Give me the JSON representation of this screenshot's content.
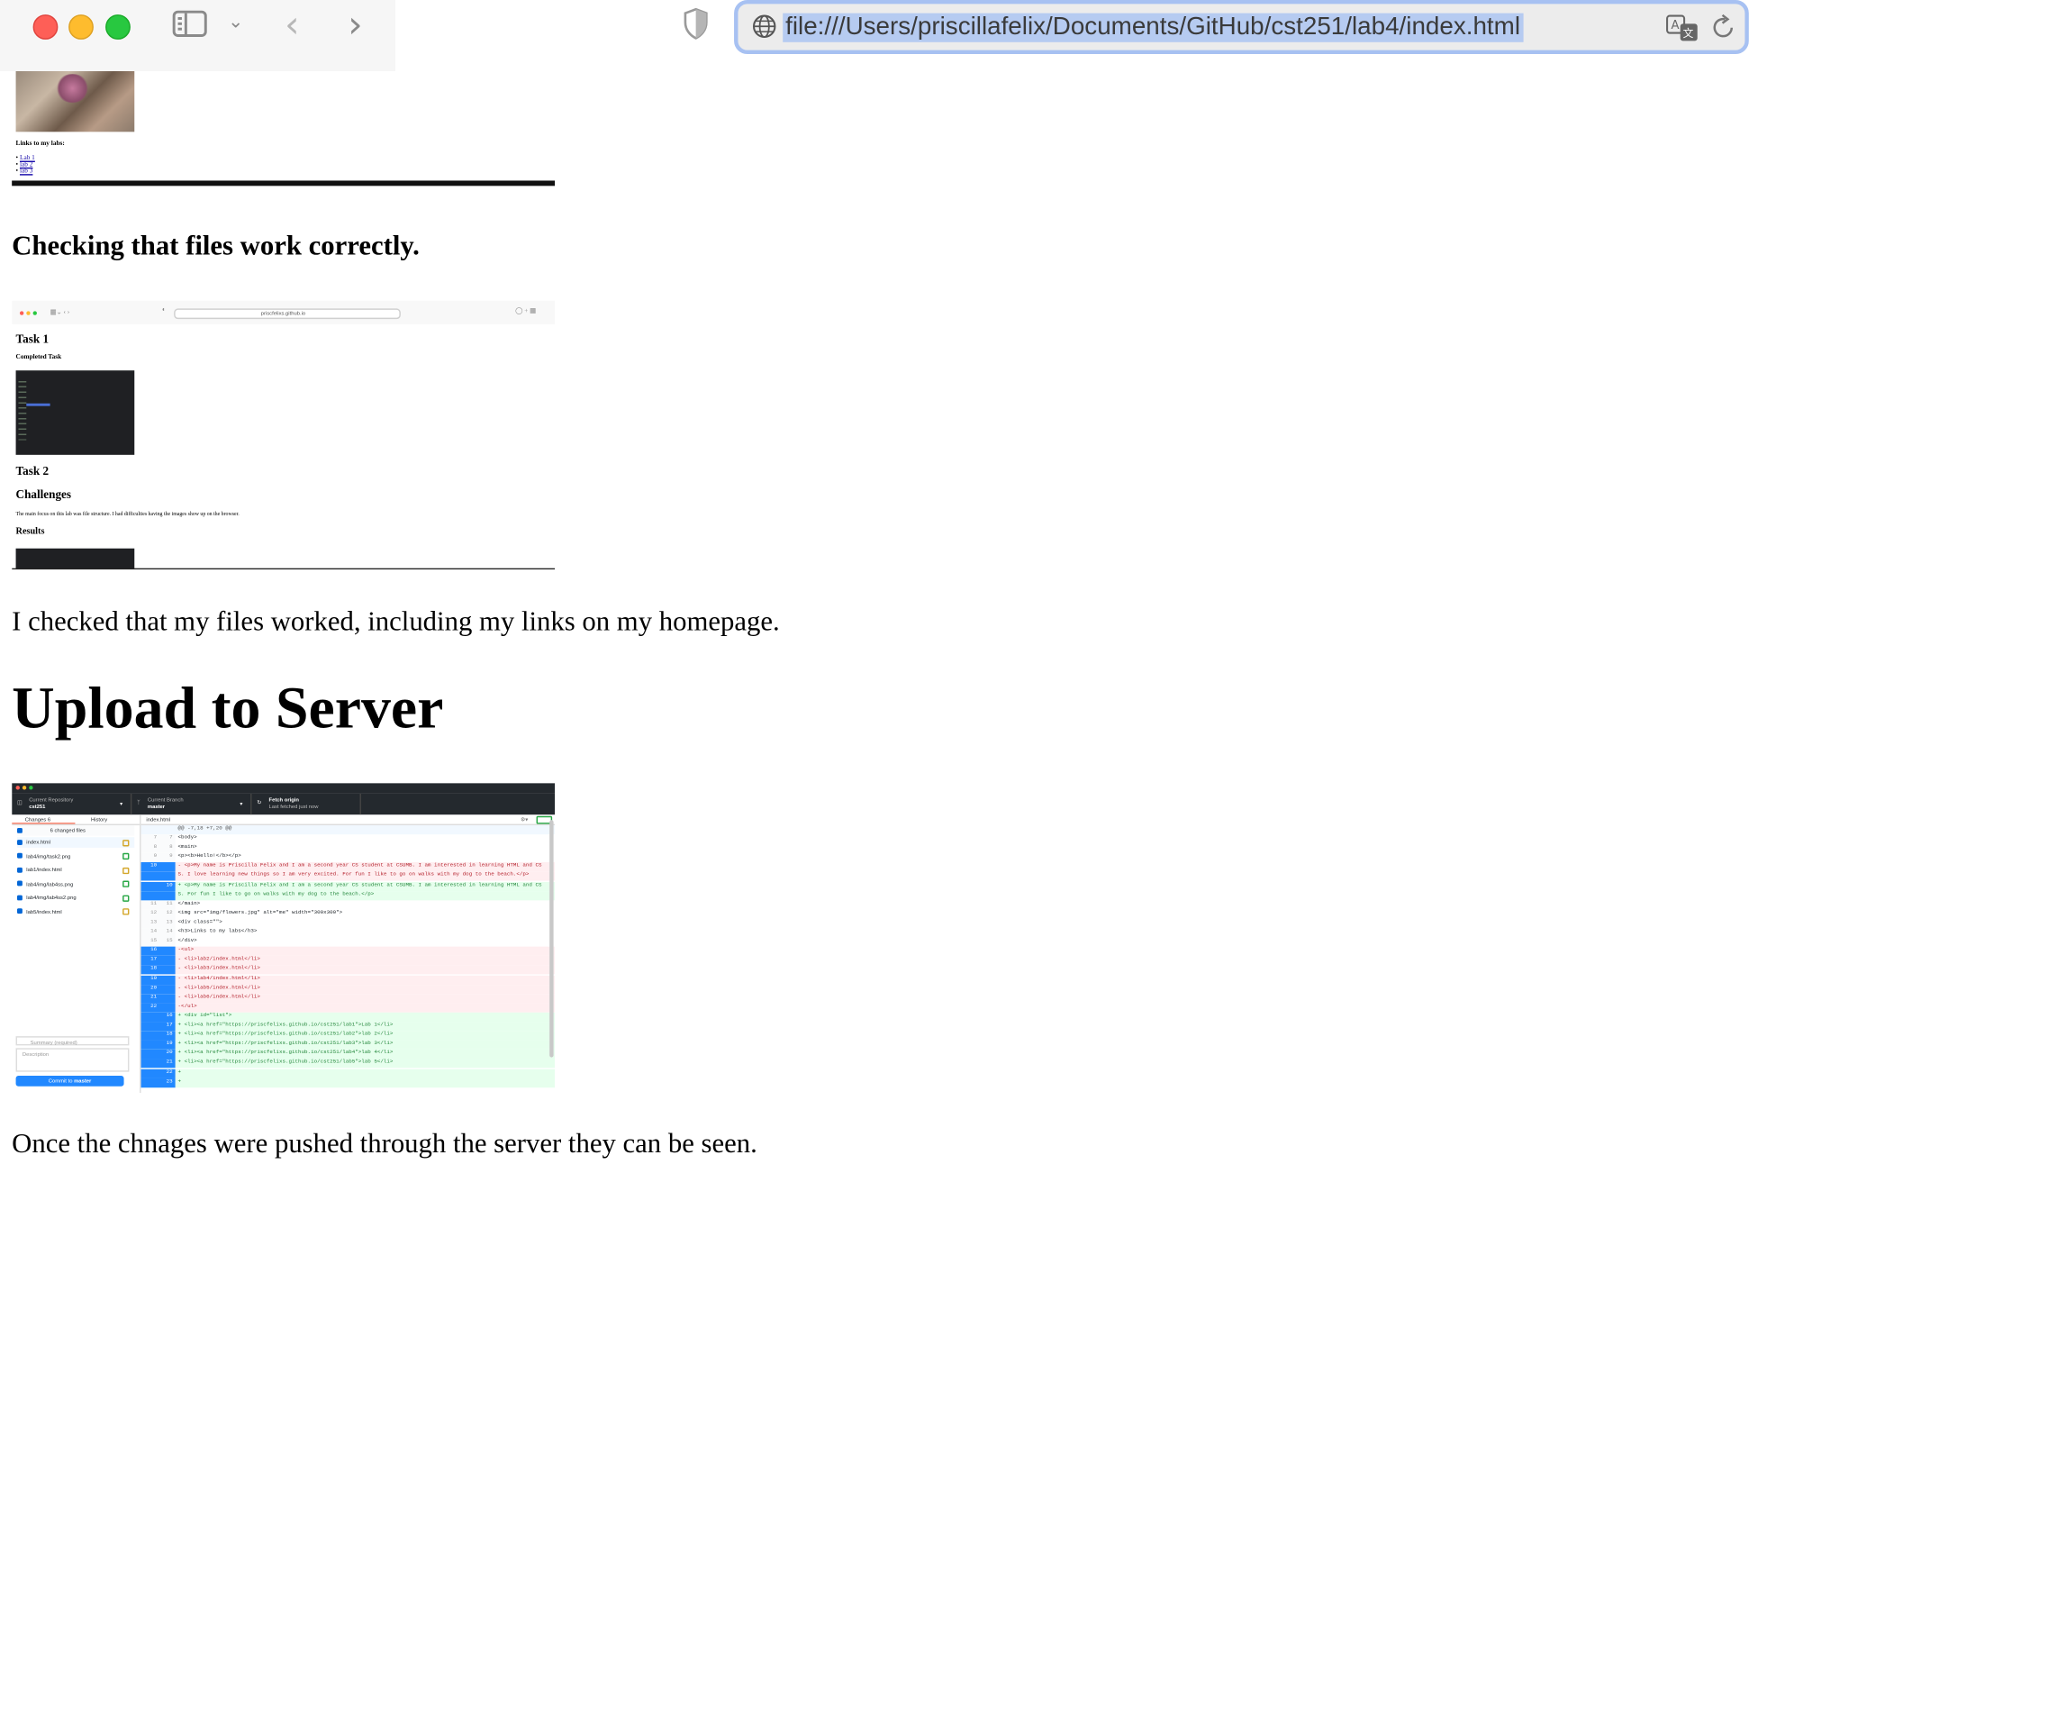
{
  "browser": {
    "url": "file:///Users/priscillafelix/Documents/GitHub/cst251/lab4/index.html",
    "icons": [
      "traffic-light-close",
      "traffic-light-minimize",
      "traffic-light-zoom",
      "sidebar-icon",
      "chevron-down-icon",
      "back-arrow-icon",
      "forward-arrow-icon",
      "shield-icon",
      "globe-icon",
      "translate-icon",
      "reload-icon"
    ]
  },
  "shot1": {
    "links_heading": "Links to my labs:",
    "links": [
      "Lab 1",
      "lab 2",
      "lab 3"
    ]
  },
  "section_check": {
    "heading": "Checking that files work correctly.",
    "caption": "I checked that my files worked, including my links on my homepage."
  },
  "shot2": {
    "url": "priscfelixs.github.io",
    "task1": "Task 1",
    "completed": "Completed Task",
    "task2": "Task 2",
    "challenges": "Challenges",
    "challenges_text": "The main focus on this lab was file structure. I had difficulties having the images show up on the browser.",
    "results": "Results"
  },
  "section_upload": {
    "heading": "Upload to Server",
    "caption": "Once the chnages were pushed through the server they can be seen."
  },
  "github_desktop": {
    "repo_label": "Current Repository",
    "repo": "cst251",
    "branch_label": "Current Branch",
    "branch": "master",
    "fetch_label": "Fetch origin",
    "fetch_sub": "Last fetched just now",
    "tab_changes": "Changes",
    "tab_changes_count": "6",
    "tab_history": "History",
    "changed_files": "6 changed files",
    "files": [
      "index.html",
      "lab4/img/task2.png",
      "lab1/index.html",
      "lab4/img/lab4ss.png",
      "lab4/img/lab4ss2.png",
      "lab5/index.html"
    ],
    "diff_file": "index.html",
    "hunk": "@@ -7,18 +7,20 @@",
    "summary_placeholder": "Summary (required)",
    "description_placeholder": "Description",
    "commit_prefix": "Commit to",
    "commit_branch": "master",
    "diff_lines": [
      {
        "o": "7",
        "n": "7",
        "t": "ctx",
        "s": "  <body>"
      },
      {
        "o": "8",
        "n": "8",
        "t": "ctx",
        "s": "    <main>"
      },
      {
        "o": "9",
        "n": "9",
        "t": "ctx",
        "s": "    <p><b>Hello!</b></p>"
      },
      {
        "o": "10",
        "n": "",
        "t": "del",
        "s": "-       <p>My name is Priscilla Felix and I am a second year CS student at CSUMB. I am interested in learning HTML and CS"
      },
      {
        "o": "",
        "n": "",
        "t": "del",
        "s": "S. I love learning new things so I am very excited. For fun I like to go on walks with my dog to the beach.</p>"
      },
      {
        "o": "",
        "n": "10",
        "t": "add",
        "s": "+       <p>My name is Priscilla Felix and I am a second year CS student at CSUMB. I am interested in learning HTML and CS"
      },
      {
        "o": "",
        "n": "",
        "t": "add",
        "s": "S. For fun I like to go on walks with my dog to the beach.</p>"
      },
      {
        "o": "11",
        "n": "11",
        "t": "ctx",
        "s": "    </main>"
      },
      {
        "o": "12",
        "n": "12",
        "t": "ctx",
        "s": "  <img src=\"img/flowers.jpg\" alt=\"me\" width=\"300x300\">"
      },
      {
        "o": "13",
        "n": "13",
        "t": "ctx",
        "s": "  <div class=\"\">"
      },
      {
        "o": "14",
        "n": "14",
        "t": "ctx",
        "s": "    <h3>Links to my labs</h3>"
      },
      {
        "o": "15",
        "n": "15",
        "t": "ctx",
        "s": "  </div>"
      },
      {
        "o": "16",
        "n": "",
        "t": "del",
        "s": "-<ul>"
      },
      {
        "o": "17",
        "n": "",
        "t": "del",
        "s": "-    <li>lab2/index.html</li>"
      },
      {
        "o": "18",
        "n": "",
        "t": "del",
        "s": "-    <li>lab3/index.html</li>"
      },
      {
        "o": "19",
        "n": "",
        "t": "del",
        "s": "-    <li>lab4/index.html</li>"
      },
      {
        "o": "20",
        "n": "",
        "t": "del",
        "s": "-    <li>lab5/index.html</li>"
      },
      {
        "o": "21",
        "n": "",
        "t": "del",
        "s": "-    <li>lab6/index.html</li>"
      },
      {
        "o": "22",
        "n": "",
        "t": "del",
        "s": "-</ul>"
      },
      {
        "o": "",
        "n": "16",
        "t": "add",
        "s": "+   <div id=\"list\">"
      },
      {
        "o": "",
        "n": "17",
        "t": "add",
        "s": "+   <li><a href=\"https://priscfelixs.github.io/cst251/lab1\">Lab 1</li>"
      },
      {
        "o": "",
        "n": "18",
        "t": "add",
        "s": "+   <li><a href=\"https://priscfelixs.github.io/cst251/lab2\">lab 2</li>"
      },
      {
        "o": "",
        "n": "19",
        "t": "add",
        "s": "+   <li><a href=\"https://priscfelixs.github.io/cst251/lab3\">lab 3</li>"
      },
      {
        "o": "",
        "n": "20",
        "t": "add",
        "s": "+   <li><a href=\"https://priscfelixs.github.io/cst251/lab4\">lab 4</li>"
      },
      {
        "o": "",
        "n": "21",
        "t": "add",
        "s": "+   <li><a href=\"https://priscfelixs.github.io/cst251/lab5\">lab 5</li>"
      },
      {
        "o": "",
        "n": "22",
        "t": "add",
        "s": "+"
      },
      {
        "o": "",
        "n": "23",
        "t": "add",
        "s": "+"
      }
    ]
  },
  "colors": {
    "accent": "#2188ff",
    "add_bg": "#e6ffed",
    "del_bg": "#ffeef0",
    "gutter_sel": "#2188ff",
    "url_focus": "#a7c1f2"
  }
}
